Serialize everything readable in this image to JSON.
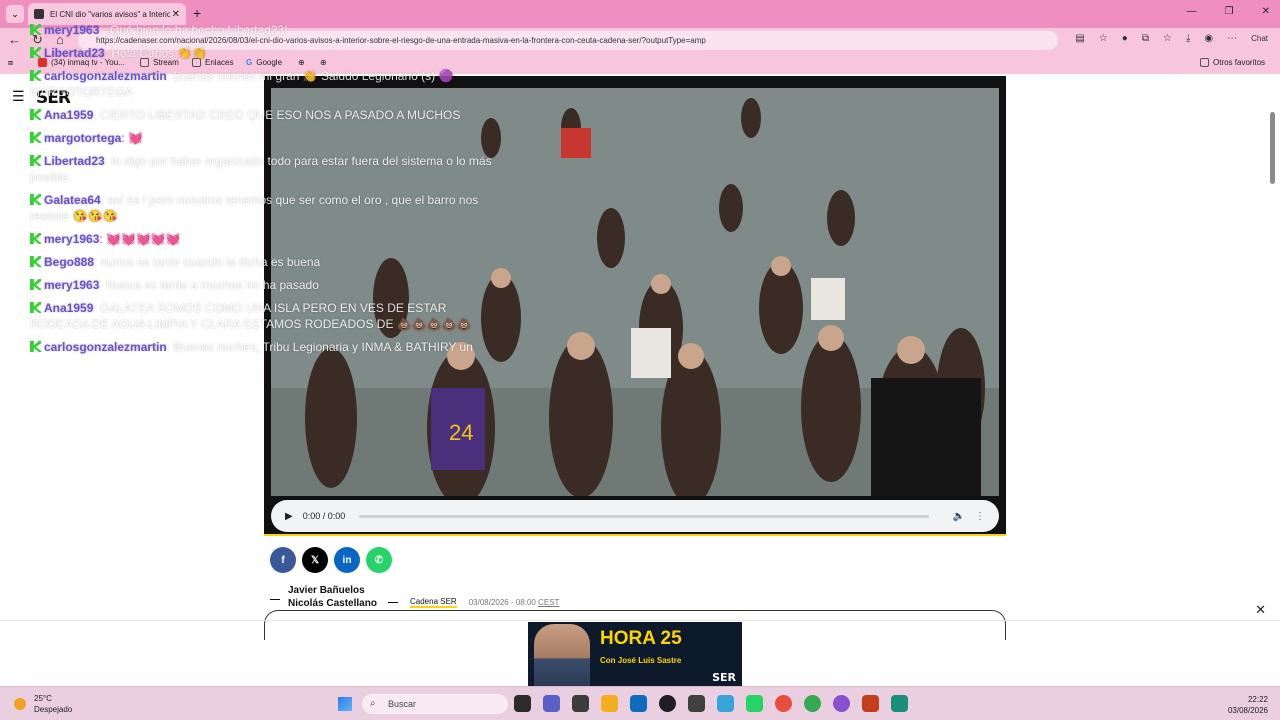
{
  "browser": {
    "tab_title": "El CNI dio \"varios avisos\" a Interior",
    "url": "https://cadenaser.com/nacional/2026/08/03/el-cni-dio-varios-avisos-a-interior-sobre-el-riesgo-de-una-entrada-masiva-en-la-frontera-con-ceuta-cadena-ser/?outputType=amp",
    "bookmarks": [
      "(34) inmaq tv - You...",
      "Stream",
      "Enlaces",
      "Google"
    ],
    "other_favorites": "Otros favoritos",
    "copilot": "Chat"
  },
  "site": {
    "logo": "SER"
  },
  "player": {
    "time": "0:00 / 0:00"
  },
  "share_buttons": [
    "facebook",
    "x",
    "linkedin",
    "whatsapp"
  ],
  "article": {
    "authors": [
      "Javier Bañuelos",
      "Nicolás Castellano"
    ],
    "source": "Cadena SER",
    "date": "03/08/2026 - 08:00",
    "tz": "CEST"
  },
  "chat": [
    {
      "user": "mery1963",
      "text": ": ¡Qué bien lo ha hecho Libertad23!"
    },
    {
      "user": "Libertad23",
      "text": ": Hola Carlos 👏👏"
    },
    {
      "user": "carlosgonzalezmartin",
      "text": ": Buenas noches mi gran 👏 Saludo Legionario (s) 🟣"
    },
    {
      "user": "",
      "text": "MARGOTORTEGA"
    },
    {
      "user": "Ana1959",
      "text": ": CIERTO LIBERTAD CREO QUE ESO NOS A PASADO A MUCHOS"
    },
    {
      "user": "margotortega",
      "text": ": 💓"
    },
    {
      "user": "Libertad23",
      "text": ": lo digo por haber organizado todo para estar fuera del sistema o lo más posible."
    },
    {
      "user": "Galatea64",
      "text": ": así es ! pero nosotros tenemos que ser como el oro , que el barro nos resbale 😘😘😘"
    },
    {
      "user": "mery1963",
      "text": ": 💓💓💓💓💓"
    },
    {
      "user": "Bego888",
      "text": ": nunca es tarde cuando la dicha es buena"
    },
    {
      "user": "mery1963",
      "text": ": Nunca es tarde a muchos no ha pasado"
    },
    {
      "user": "Ana1959",
      "text": ": GALATEA SOMOS COMO UNA ISLA PERO EN VES DE ESTAR RODEADA DE AGUA LIMPIA Y CLARA ESTAMOS RODEADOS DE 💩💩💩💩💩"
    },
    {
      "user": "carlosgonzalezmartin",
      "text": ": Buenas noches, Tribu Legionaria y INMA & BATHIRY un saludo"
    }
  ],
  "ad": {
    "title": "HORA 25",
    "subtitle": "Con José Luis Sastre",
    "brand": "SER"
  },
  "taskbar": {
    "temp": "25°C",
    "weather": "Despejado",
    "search": "Buscar",
    "time": "22:22",
    "date": "03/08/2026"
  },
  "colors": {
    "tabbar": "#ee8fc0",
    "accent": "#ffd400",
    "chat_user": "#6b4fd3",
    "kick_green": "#35d235"
  }
}
